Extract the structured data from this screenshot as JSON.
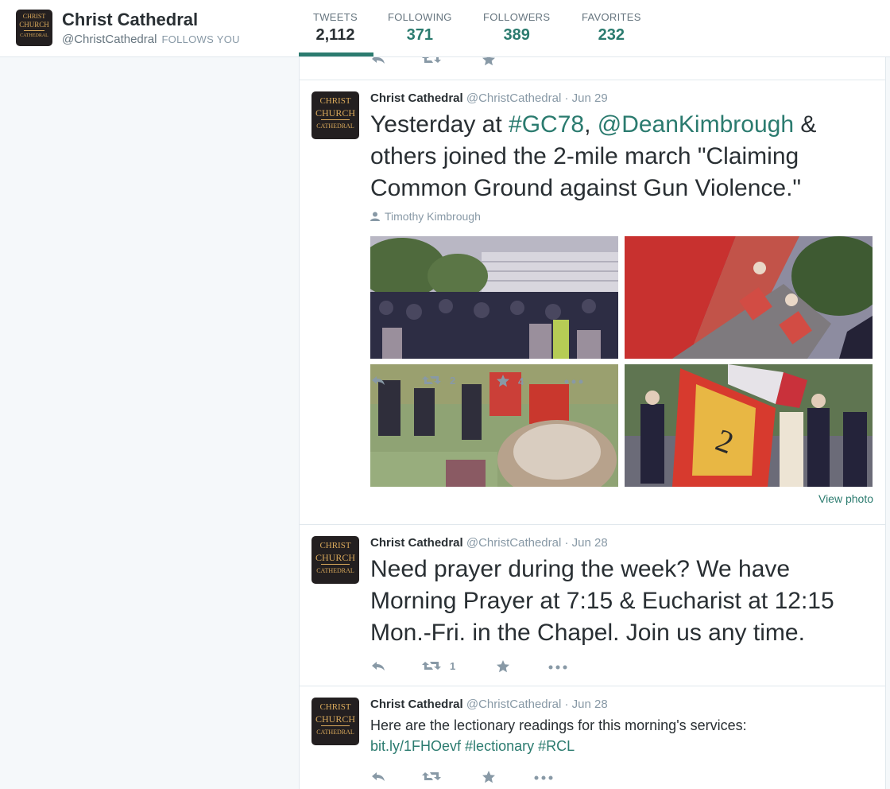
{
  "profile": {
    "name": "Christ Cathedral",
    "handle": "@ChristCathedral",
    "follows_you": "FOLLOWS YOU",
    "logo": {
      "line1": "CHRIST",
      "line2": "CHURCH",
      "line3": "CATHEDRAL"
    }
  },
  "stats": [
    {
      "label": "TWEETS",
      "value": "2,112"
    },
    {
      "label": "FOLLOWING",
      "value": "371"
    },
    {
      "label": "FOLLOWERS",
      "value": "389"
    },
    {
      "label": "FAVORITES",
      "value": "232"
    }
  ],
  "tweets": [
    {
      "name": "Christ Cathedral",
      "handle": "@ChristCathedral",
      "date": "Jun 29",
      "text_parts": [
        "Yesterday at ",
        "#GC78",
        ", ",
        "@DeanKimbrough",
        " & others joined the 2-mile march \"Claiming Common Ground against Gun Violence.\""
      ],
      "tagged": "Timothy Kimbrough",
      "retweets": "2",
      "favorites": "4",
      "view_photo": "View photo"
    },
    {
      "name": "Christ Cathedral",
      "handle": "@ChristCathedral",
      "date": "Jun 28",
      "text": "Need prayer during the week? We have Morning Prayer at 7:15 & Eucharist at 12:15 Mon.-Fri. in the Chapel. Join us any time.",
      "retweets": "1",
      "favorites": ""
    },
    {
      "name": "Christ Cathedral",
      "handle": "@ChristCathedral",
      "date": "Jun 28",
      "text_line1": "Here are the lectionary readings for this morning's services:",
      "link1": "bit.ly/1FHOevf",
      "hashtag1": "#lectionary",
      "hashtag2": "#RCL"
    }
  ],
  "separator": "·",
  "colors": {
    "accent": "#2b7b6f",
    "text": "#292f33",
    "muted": "#8899a6",
    "logo_bg": "#231f20",
    "logo_text": "#d9a95b"
  },
  "icons": [
    "reply-icon",
    "retweet-icon",
    "favorite-icon",
    "more-icon",
    "person-icon"
  ]
}
